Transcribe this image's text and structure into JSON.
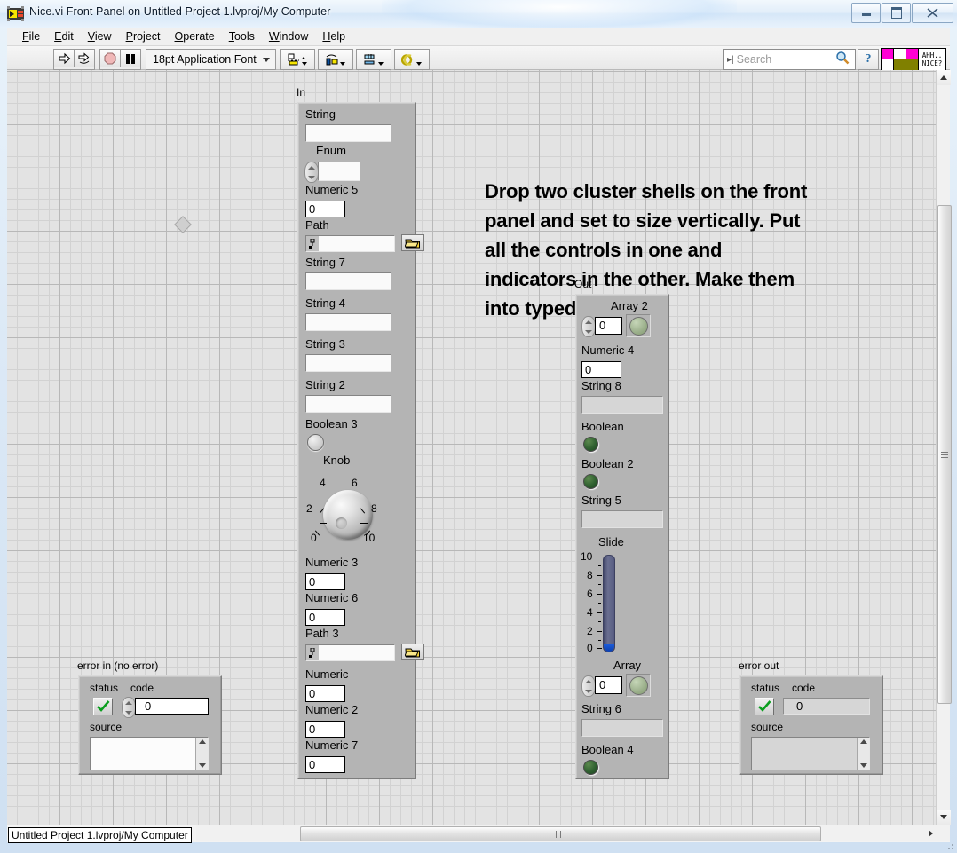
{
  "window": {
    "title": "Nice.vi Front Panel on Untitled Project 1.lvproj/My Computer",
    "icon": "labview-vi-icon",
    "minimize": "minimize-button",
    "maximize": "maximize-button",
    "close": "close-button"
  },
  "menu": {
    "items": [
      {
        "label": "File",
        "accel": "F"
      },
      {
        "label": "Edit",
        "accel": "E"
      },
      {
        "label": "View",
        "accel": "V"
      },
      {
        "label": "Project",
        "accel": "P"
      },
      {
        "label": "Operate",
        "accel": "O"
      },
      {
        "label": "Tools",
        "accel": "T"
      },
      {
        "label": "Window",
        "accel": "W"
      },
      {
        "label": "Help",
        "accel": "H"
      }
    ]
  },
  "toolbar": {
    "run": "run-arrow-icon",
    "run_continuously": "run-continuously-icon",
    "abort": "abort-execution-icon",
    "pause": "pause-icon",
    "font_selector": "18pt Application Font",
    "align_objects": "align-objects-icon",
    "distribute_objects": "distribute-objects-icon",
    "resize_objects": "resize-objects-icon",
    "reorder": "reorder-icon",
    "search_placeholder": "Search",
    "search_icon": "magnifier-icon",
    "help_icon": "context-help-question-icon",
    "badge_text_line1": "AHH..",
    "badge_text_line2": "NICE?",
    "badge_color_magenta": "#ff00d4",
    "badge_color_olive": "#808000"
  },
  "banner": {
    "text": "Drop two cluster shells on the front panel and set to size vertically. Put all the controls in one and indicators in the other. Make them into typedefs."
  },
  "in_cluster": {
    "label": "In",
    "controls": [
      {
        "name": "String",
        "type": "string",
        "value": ""
      },
      {
        "name": "Enum",
        "type": "enum",
        "value": ""
      },
      {
        "name": "Numeric 5",
        "type": "numeric",
        "value": "0"
      },
      {
        "name": "Path",
        "type": "path",
        "value": ""
      },
      {
        "name": "String 7",
        "type": "string",
        "value": ""
      },
      {
        "name": "String 4",
        "type": "string",
        "value": ""
      },
      {
        "name": "String 3",
        "type": "string",
        "value": ""
      },
      {
        "name": "String 2",
        "type": "string",
        "value": ""
      },
      {
        "name": "Boolean 3",
        "type": "boolean",
        "value": "off"
      },
      {
        "name": "Knob",
        "type": "knob",
        "value": "0"
      },
      {
        "name": "Numeric 3",
        "type": "numeric",
        "value": "0"
      },
      {
        "name": "Numeric 6",
        "type": "numeric",
        "value": "0"
      },
      {
        "name": "Path 3",
        "type": "path",
        "value": ""
      },
      {
        "name": "Numeric",
        "type": "numeric",
        "value": "0"
      },
      {
        "name": "Numeric 2",
        "type": "numeric",
        "value": "0"
      },
      {
        "name": "Numeric 7",
        "type": "numeric",
        "value": "0"
      }
    ],
    "knob": {
      "ticks": [
        "0",
        "2",
        "4",
        "6",
        "8",
        "10"
      ],
      "min": 0,
      "max": 10,
      "value": 0
    }
  },
  "out_cluster": {
    "label": "Out",
    "indicators": [
      {
        "name": "Array 2",
        "type": "array",
        "index": "0"
      },
      {
        "name": "Numeric 4",
        "type": "numeric",
        "value": "0"
      },
      {
        "name": "String 8",
        "type": "string",
        "value": ""
      },
      {
        "name": "Boolean",
        "type": "boolean",
        "value": "off"
      },
      {
        "name": "Boolean 2",
        "type": "boolean",
        "value": "off"
      },
      {
        "name": "String 5",
        "type": "string",
        "value": ""
      },
      {
        "name": "Slide",
        "type": "slide",
        "value": "0"
      },
      {
        "name": "Array",
        "type": "array",
        "index": "0"
      },
      {
        "name": "String 6",
        "type": "string",
        "value": ""
      },
      {
        "name": "Boolean 4",
        "type": "boolean",
        "value": "off"
      }
    ],
    "slide": {
      "ticks": [
        "10",
        "8",
        "6",
        "4",
        "2",
        "0"
      ],
      "min": 0,
      "max": 10,
      "value": 0
    }
  },
  "error_in": {
    "title": "error in (no error)",
    "status_label": "status",
    "status_value": "no-error-check",
    "code_label": "code",
    "code_value": "0",
    "source_label": "source",
    "source_value": ""
  },
  "error_out": {
    "title": "error out",
    "status_label": "status",
    "status_value": "no-error-check",
    "code_label": "code",
    "code_value": "0",
    "source_label": "source",
    "source_value": ""
  },
  "statusbar": {
    "context": "Untitled Project 1.lvproj/My Computer"
  }
}
